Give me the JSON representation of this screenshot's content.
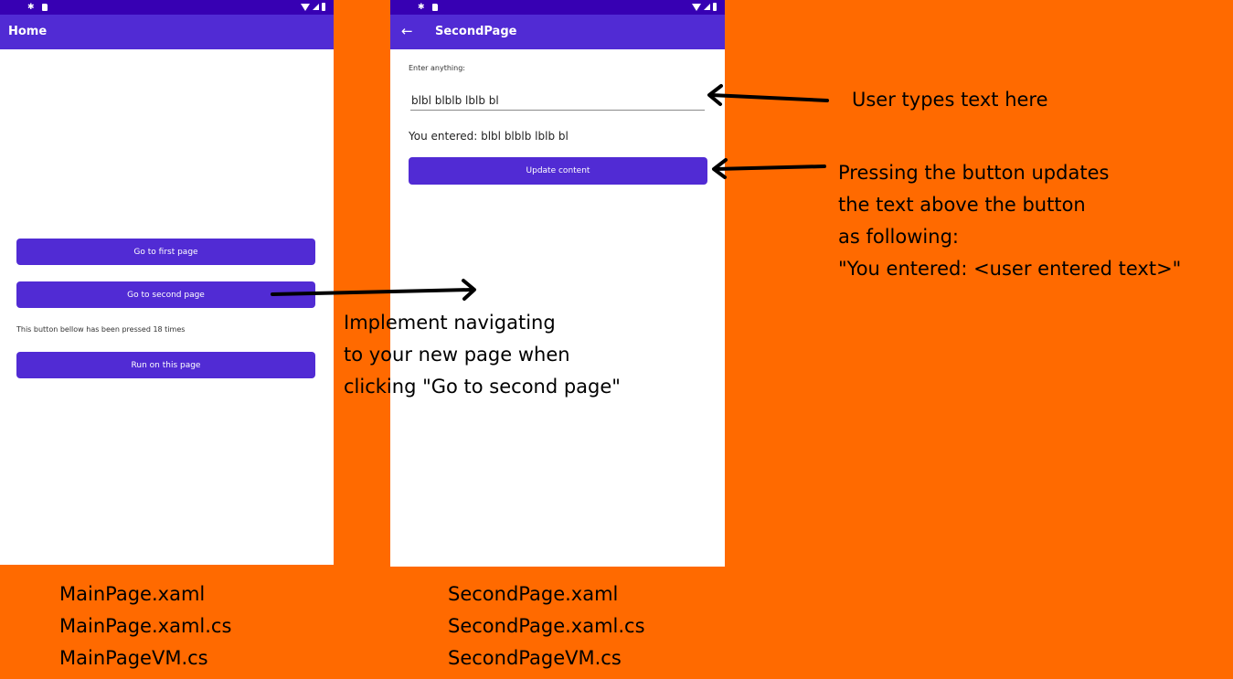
{
  "main_page": {
    "title": "Home",
    "go_first_label": "Go to first page",
    "go_second_label": "Go to second page",
    "counter_text": "This button bellow has been pressed 18 times",
    "run_label": "Run on this page"
  },
  "second_page": {
    "title": "SecondPage",
    "entry_label": "Enter anything:",
    "entry_value": "blbl blblb lblb bl",
    "result_text": "You entered: blbl blblb lblb bl",
    "update_label": "Update content"
  },
  "annotations": {
    "navigate": [
      "Implement navigating",
      "to your new page when",
      "clicking \"Go to second page\""
    ],
    "user_types": "User types text here",
    "pressing": [
      "Pressing the button updates",
      "the text above the button",
      "as following:",
      "\"You entered: <user entered text>\""
    ]
  },
  "files": {
    "main": [
      "MainPage.xaml",
      "MainPage.xaml.cs",
      "MainPageVM.cs"
    ],
    "second": [
      "SecondPage.xaml",
      "SecondPage.xaml.cs",
      "SecondPageVM.cs"
    ]
  },
  "icons": {
    "status_left": [
      "gear-icon",
      "sd-card-icon"
    ],
    "status_right": [
      "wifi-icon",
      "signal-icon",
      "battery-icon"
    ],
    "back": "back-arrow-icon"
  },
  "colors": {
    "background": "#FF6A00",
    "primary": "#512BD4",
    "status_bar": "#3700B3"
  }
}
